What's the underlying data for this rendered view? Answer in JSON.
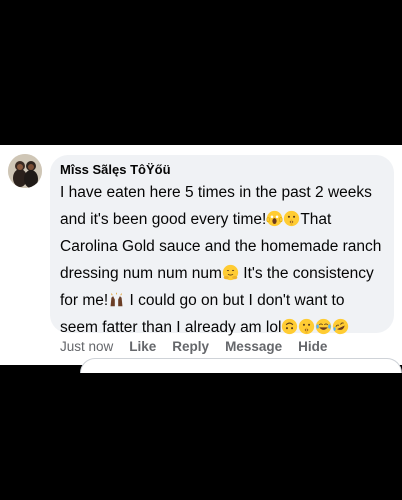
{
  "comment": {
    "author": "Mîss Sãlęs TôŸőü",
    "text_parts": [
      "I have eaten here 5 times in the past 2 weeks and it's been good every time!",
      "That Carolina Gold sauce and the homemade ranch dressing num num num",
      " It's the consistency for me!",
      " I could go on but I don't want to seem fatter than I already am lol"
    ],
    "emojis": [
      "screaming-face-emoji",
      "shushing-face-emoji",
      "hugging-face-emoji",
      "raising-hands-emoji",
      "upside-down-face-emoji",
      "shushing-face-emoji",
      "tears-of-joy-emoji",
      "rofl-emoji"
    ]
  },
  "actions": {
    "time": "Just now",
    "like": "Like",
    "reply": "Reply",
    "message": "Message",
    "hide": "Hide"
  },
  "colors": {
    "bubble": "#f0f2f5",
    "text": "#050505",
    "muted": "#65676b",
    "emoji_yellow": "#ffcc33"
  }
}
